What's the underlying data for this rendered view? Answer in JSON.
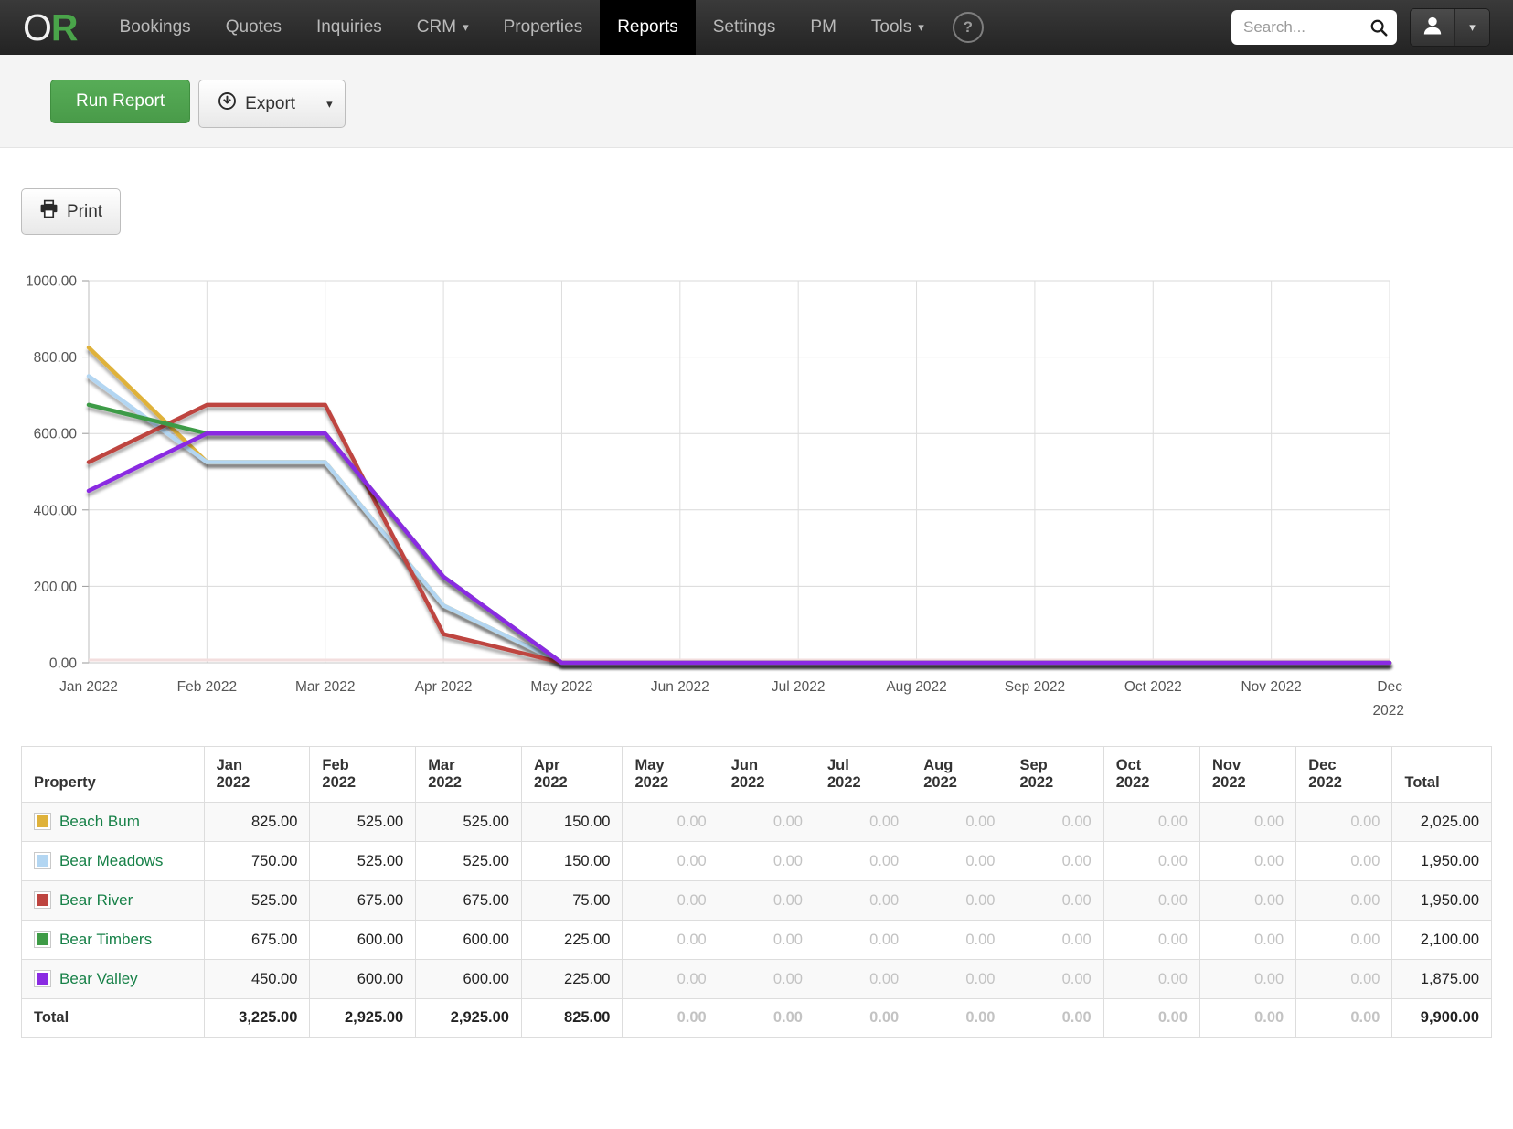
{
  "nav": {
    "logo_o": "O",
    "logo_r": "R",
    "items": [
      {
        "label": "Bookings"
      },
      {
        "label": "Quotes"
      },
      {
        "label": "Inquiries"
      },
      {
        "label": "CRM",
        "caret": true
      },
      {
        "label": "Properties"
      },
      {
        "label": "Reports",
        "active": true
      },
      {
        "label": "Settings"
      },
      {
        "label": "PM"
      },
      {
        "label": "Tools",
        "caret": true
      }
    ],
    "help_label": "?",
    "search_placeholder": "Search..."
  },
  "toolbar": {
    "run_report_label": "Run Report",
    "export_label": "Export"
  },
  "print_label": "Print",
  "chart_data": {
    "type": "line",
    "x": [
      "Jan 2022",
      "Feb 2022",
      "Mar 2022",
      "Apr 2022",
      "May 2022",
      "Jun 2022",
      "Jul 2022",
      "Aug 2022",
      "Sep 2022",
      "Oct 2022",
      "Nov 2022",
      "Dec 2022"
    ],
    "ylim": [
      0,
      1000
    ],
    "yticks": [
      {
        "v": 0,
        "label": "0.00"
      },
      {
        "v": 200,
        "label": "200.00"
      },
      {
        "v": 400,
        "label": "400.00"
      },
      {
        "v": 600,
        "label": "600.00"
      },
      {
        "v": 800,
        "label": "800.00"
      },
      {
        "v": 1000,
        "label": "1000.00"
      }
    ],
    "grid": true,
    "legend_position": "table-below",
    "series": [
      {
        "name": "Beach Bum",
        "color": "#DFB23B",
        "values": [
          825,
          525,
          525,
          150,
          0,
          0,
          0,
          0,
          0,
          0,
          0,
          0
        ]
      },
      {
        "name": "Bear Meadows",
        "color": "#B3D6F2",
        "values": [
          750,
          525,
          525,
          150,
          0,
          0,
          0,
          0,
          0,
          0,
          0,
          0
        ]
      },
      {
        "name": "Bear River",
        "color": "#BE4540",
        "values": [
          525,
          675,
          675,
          75,
          0,
          0,
          0,
          0,
          0,
          0,
          0,
          0
        ]
      },
      {
        "name": "Bear Timbers",
        "color": "#3E9B46",
        "values": [
          675,
          600,
          600,
          225,
          0,
          0,
          0,
          0,
          0,
          0,
          0,
          0
        ]
      },
      {
        "name": "Bear Valley",
        "color": "#8A2BE2",
        "values": [
          450,
          600,
          600,
          225,
          0,
          0,
          0,
          0,
          0,
          0,
          0,
          0
        ]
      }
    ]
  },
  "table": {
    "property_header": "Property",
    "month_headers": [
      "Jan\n2022",
      "Feb\n2022",
      "Mar\n2022",
      "Apr\n2022",
      "May\n2022",
      "Jun\n2022",
      "Jul\n2022",
      "Aug\n2022",
      "Sep\n2022",
      "Oct\n2022",
      "Nov\n2022",
      "Dec\n2022"
    ],
    "total_header": "Total",
    "rows": [
      {
        "name": "Beach Bum",
        "color": "#DFB23B",
        "values": [
          "825.00",
          "525.00",
          "525.00",
          "150.00",
          "0.00",
          "0.00",
          "0.00",
          "0.00",
          "0.00",
          "0.00",
          "0.00",
          "0.00"
        ],
        "total": "2,025.00"
      },
      {
        "name": "Bear Meadows",
        "color": "#B3D6F2",
        "values": [
          "750.00",
          "525.00",
          "525.00",
          "150.00",
          "0.00",
          "0.00",
          "0.00",
          "0.00",
          "0.00",
          "0.00",
          "0.00",
          "0.00"
        ],
        "total": "1,950.00"
      },
      {
        "name": "Bear River",
        "color": "#BE4540",
        "values": [
          "525.00",
          "675.00",
          "675.00",
          "75.00",
          "0.00",
          "0.00",
          "0.00",
          "0.00",
          "0.00",
          "0.00",
          "0.00",
          "0.00"
        ],
        "total": "1,950.00"
      },
      {
        "name": "Bear Timbers",
        "color": "#3E9B46",
        "values": [
          "675.00",
          "600.00",
          "600.00",
          "225.00",
          "0.00",
          "0.00",
          "0.00",
          "0.00",
          "0.00",
          "0.00",
          "0.00",
          "0.00"
        ],
        "total": "2,100.00"
      },
      {
        "name": "Bear Valley",
        "color": "#8A2BE2",
        "values": [
          "450.00",
          "600.00",
          "600.00",
          "225.00",
          "0.00",
          "0.00",
          "0.00",
          "0.00",
          "0.00",
          "0.00",
          "0.00",
          "0.00"
        ],
        "total": "1,875.00"
      }
    ],
    "total_row": {
      "label": "Total",
      "values": [
        "3,225.00",
        "2,925.00",
        "2,925.00",
        "825.00",
        "0.00",
        "0.00",
        "0.00",
        "0.00",
        "0.00",
        "0.00",
        "0.00",
        "0.00"
      ],
      "total": "9,900.00"
    }
  }
}
